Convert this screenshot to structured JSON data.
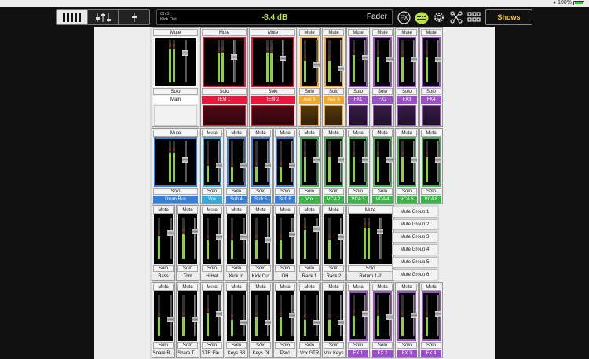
{
  "status": {
    "battery": "100%"
  },
  "header": {
    "view_tabs": [
      "mixer-view-icon",
      "faders-view-icon",
      "single-fader-icon"
    ],
    "channel_number": "Ch 5",
    "channel_name": "Kick Out",
    "level": "-8.4 dB",
    "mode": "Fader",
    "shows_label": "Shows"
  },
  "labels": {
    "mute": "Mute",
    "solo": "Solo"
  },
  "colors": {
    "main": "#ffffff",
    "iem": "#e8193c",
    "aux": "#f5a623",
    "fx": "#9b4fc9",
    "bus": "#3a7fd6",
    "vox": "#37a8d8",
    "vca": "#3cb44b"
  },
  "rows": [
    [
      {
        "label": "Main",
        "kind": "main",
        "color": "#ffffff",
        "level": 0.78,
        "fader": 0.72
      },
      {
        "label": "IEM 1",
        "kind": "wide",
        "color": "#e8193c",
        "level": 0.7,
        "fader": 0.62
      },
      {
        "label": "IEM 2",
        "kind": "wide",
        "color": "#e8193c",
        "level": 0.7,
        "fader": 0.58
      },
      {
        "label": "Aux 5",
        "kind": "narrow",
        "color": "#f5a623",
        "level": 0.5,
        "fader": 0.4
      },
      {
        "label": "Aux 6",
        "kind": "narrow",
        "color": "#f5a623",
        "level": 0.5,
        "fader": 0.3
      },
      {
        "label": "FX1",
        "kind": "narrow",
        "color": "#9b4fc9",
        "level": 0.65,
        "fader": 0.6
      },
      {
        "label": "FX2",
        "kind": "narrow",
        "color": "#9b4fc9",
        "level": 0.6,
        "fader": 0.55
      },
      {
        "label": "FX3",
        "kind": "narrow",
        "color": "#9b4fc9",
        "level": 0.6,
        "fader": 0.55
      },
      {
        "label": "FX4",
        "kind": "narrow",
        "color": "#9b4fc9",
        "level": 0.6,
        "fader": 0.55
      }
    ],
    [
      {
        "label": "Drum Bus",
        "kind": "wide",
        "color": "#3a7fd6",
        "level": 0.7,
        "fader": 0.55
      },
      {
        "label": "Vox",
        "kind": "narrow",
        "color": "#37a8d8",
        "level": 0.4,
        "fader": 0.4
      },
      {
        "label": "Sub 4",
        "kind": "narrow",
        "color": "#3a7fd6",
        "level": 0.35,
        "fader": 0.4
      },
      {
        "label": "Sub 5",
        "kind": "narrow",
        "color": "#3a7fd6",
        "level": 0.35,
        "fader": 0.4
      },
      {
        "label": "Sub 6",
        "kind": "narrow",
        "color": "#3a7fd6",
        "level": 0.35,
        "fader": 0.4
      },
      {
        "label": "Vox",
        "kind": "narrow",
        "color": "#3cb44b",
        "level": 0.6,
        "fader": 0.55
      },
      {
        "label": "VCA 2",
        "kind": "narrow",
        "color": "#3cb44b",
        "level": 0.6,
        "fader": 0.55
      },
      {
        "label": "VCA 3",
        "kind": "narrow",
        "color": "#3cb44b",
        "level": 0.6,
        "fader": 0.55
      },
      {
        "label": "VCA 4",
        "kind": "narrow",
        "color": "#3cb44b",
        "level": 0.6,
        "fader": 0.55
      },
      {
        "label": "VCA 5",
        "kind": "narrow",
        "color": "#3cb44b",
        "level": 0.6,
        "fader": 0.55
      },
      {
        "label": "VCA 6",
        "kind": "narrow",
        "color": "#3cb44b",
        "level": 0.6,
        "fader": 0.55
      }
    ],
    [
      {
        "label": "Bass",
        "kind": "narrow",
        "color": "",
        "level": 0.55,
        "fader": 0.65
      },
      {
        "label": "Tom",
        "kind": "narrow",
        "color": "",
        "level": 0.6,
        "fader": 0.7
      },
      {
        "label": "H.Hat",
        "kind": "narrow",
        "color": "",
        "level": 0.45,
        "fader": 0.55
      },
      {
        "label": "Kick In",
        "kind": "narrow",
        "color": "",
        "level": 0.45,
        "fader": 0.55
      },
      {
        "label": "Kick Out",
        "kind": "narrow",
        "color": "",
        "level": 0.45,
        "fader": 0.45
      },
      {
        "label": "OH",
        "kind": "narrow",
        "color": "",
        "level": 0.45,
        "fader": 0.6
      },
      {
        "label": "Rack 1",
        "kind": "narrow",
        "color": "",
        "level": 0.7,
        "fader": 0.75
      },
      {
        "label": "Rack 2",
        "kind": "narrow",
        "color": "",
        "level": 0.45,
        "fader": 0.55
      },
      {
        "label": "Return 1-2",
        "kind": "wide",
        "color": "",
        "level": 0.75,
        "fader": 0.7
      }
    ],
    [
      {
        "label": "Snare B...",
        "kind": "narrow",
        "color": "",
        "level": 0.45,
        "fader": 0.4
      },
      {
        "label": "Snare T...",
        "kind": "narrow",
        "color": "",
        "level": 0.45,
        "fader": 0.4
      },
      {
        "label": "GTR Ele...",
        "kind": "narrow",
        "color": "",
        "level": 0.55,
        "fader": 0.55
      },
      {
        "label": "Keys B3",
        "kind": "narrow",
        "color": "",
        "level": 0.4,
        "fader": 0.3
      },
      {
        "label": "Keys DI",
        "kind": "narrow",
        "color": "",
        "level": 0.45,
        "fader": 0.3
      },
      {
        "label": "Perc",
        "kind": "narrow",
        "color": "",
        "level": 0.45,
        "fader": 0.5
      },
      {
        "label": "Vox GTR",
        "kind": "narrow",
        "color": "",
        "level": 0.4,
        "fader": 0.3
      },
      {
        "label": "Vox Keys",
        "kind": "narrow",
        "color": "",
        "level": 0.4,
        "fader": 0.3
      },
      {
        "label": "FX 1",
        "kind": "narrow",
        "color": "#9b4fc9",
        "level": 0.5,
        "fader": 0.55
      },
      {
        "label": "FX 2",
        "kind": "narrow",
        "color": "#9b4fc9",
        "level": 0.5,
        "fader": 0.45
      },
      {
        "label": "FX 3",
        "kind": "narrow",
        "color": "#9b4fc9",
        "level": 0.45,
        "fader": 0.5
      },
      {
        "label": "FX 4",
        "kind": "narrow",
        "color": "#9b4fc9",
        "level": 0.45,
        "fader": 0.55
      }
    ]
  ],
  "mute_groups": [
    "Mute Group 1",
    "Mute Group 2",
    "Mute Group 3",
    "Mute Group 4",
    "Mute Group 5",
    "Mute Group 6"
  ]
}
